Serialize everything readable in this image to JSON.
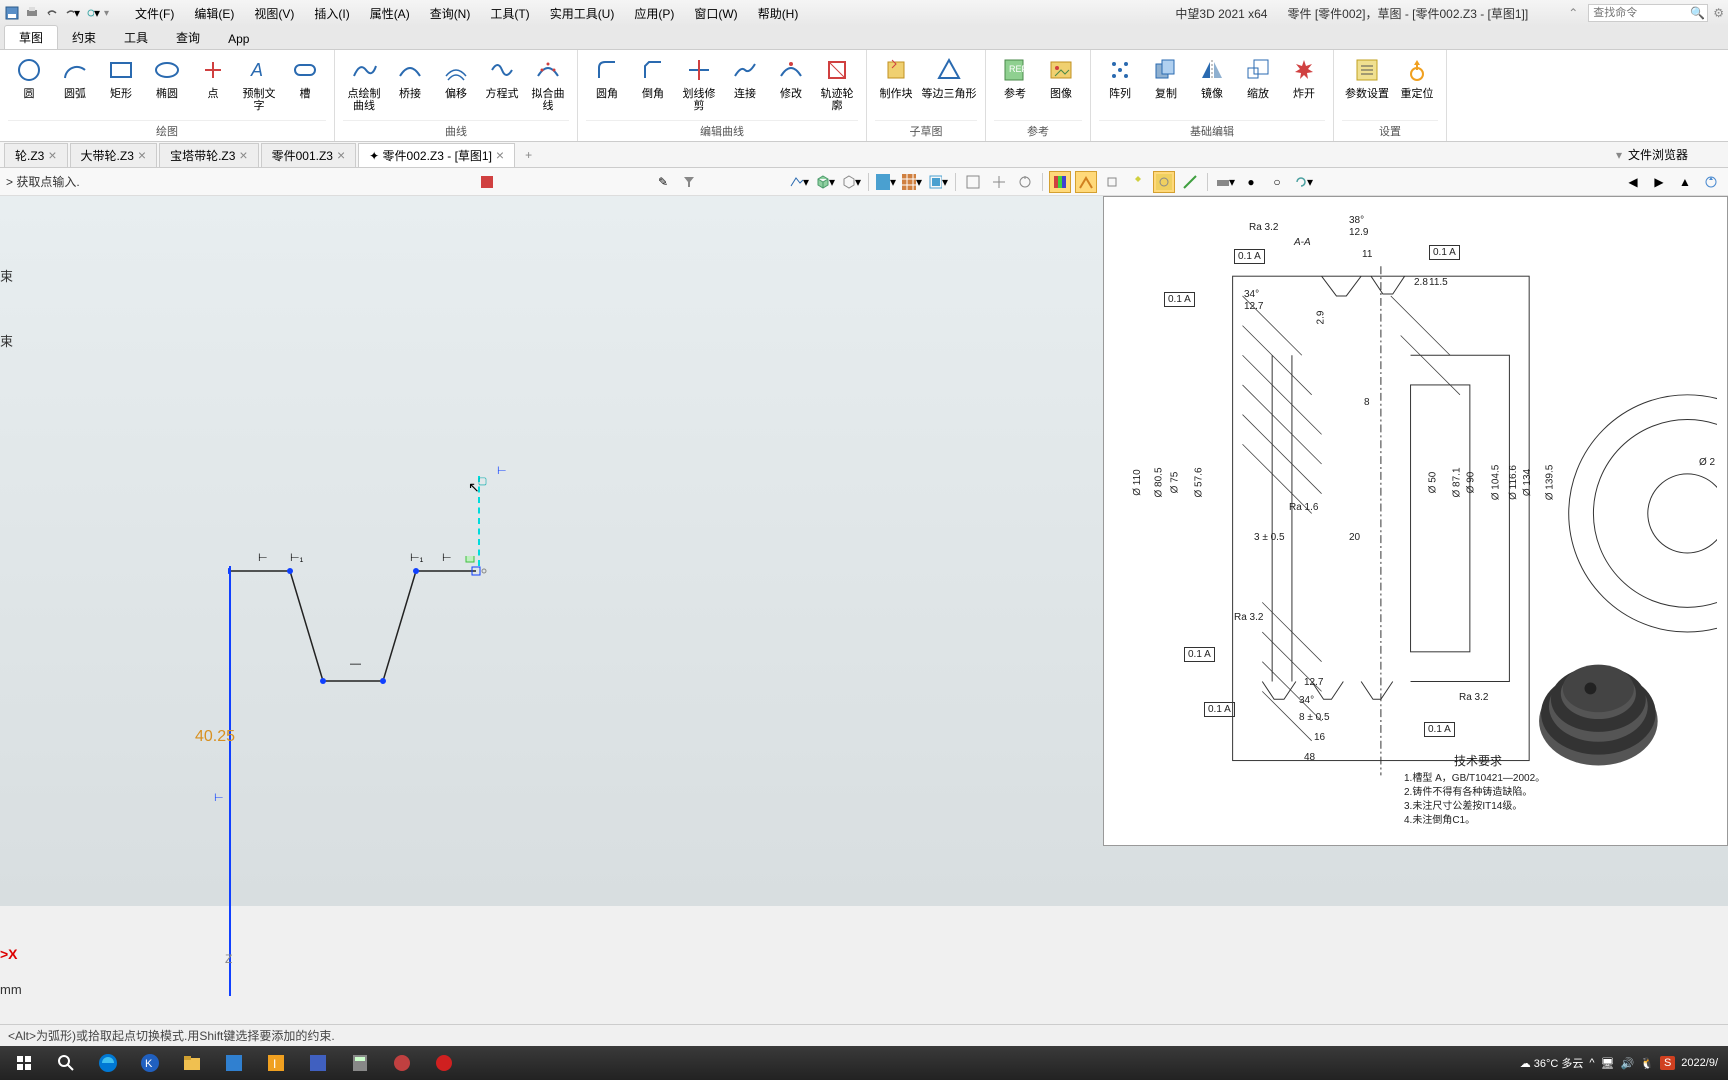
{
  "titlebar": {
    "menus": [
      "文件(F)",
      "编辑(E)",
      "视图(V)",
      "插入(I)",
      "属性(A)",
      "查询(N)",
      "工具(T)",
      "实用工具(U)",
      "应用(P)",
      "窗口(W)",
      "帮助(H)"
    ],
    "app_name": "中望3D 2021 x64",
    "doc_title": "零件 [零件002]，草图 - [零件002.Z3 - [草图1]]",
    "search_placeholder": "查找命令"
  },
  "ribbon_tabs": [
    "草图",
    "约束",
    "工具",
    "查询",
    "App"
  ],
  "ribbon_active_tab": 0,
  "ribbon_groups": [
    {
      "label": "绘图",
      "tools": [
        "圆",
        "圆弧",
        "矩形",
        "椭圆",
        "点",
        "预制文字",
        "槽"
      ]
    },
    {
      "label": "曲线",
      "tools": [
        "点绘制曲线",
        "桥接",
        "偏移",
        "方程式",
        "拟合曲线"
      ]
    },
    {
      "label": "编辑曲线",
      "tools": [
        "圆角",
        "倒角",
        "划线修剪",
        "连接",
        "修改",
        "轨迹轮廓"
      ]
    },
    {
      "label": "子草图",
      "tools": [
        "制作块",
        "等边三角形"
      ]
    },
    {
      "label": "参考",
      "tools": [
        "参考",
        "图像"
      ]
    },
    {
      "label": "基础编辑",
      "tools": [
        "阵列",
        "复制",
        "镜像",
        "缩放",
        "炸开"
      ]
    },
    {
      "label": "设置",
      "tools": [
        "参数设置",
        "重定位"
      ]
    }
  ],
  "doc_tabs": [
    {
      "name": "轮.Z3",
      "active": false
    },
    {
      "name": "大带轮.Z3",
      "active": false
    },
    {
      "name": "宝塔带轮.Z3",
      "active": false
    },
    {
      "name": "零件001.Z3",
      "active": false
    },
    {
      "name": "✦ 零件002.Z3 - [草图1]",
      "active": true
    }
  ],
  "right_panel_title": "文件浏览器",
  "prompt_text": "> 获取点输入.",
  "constraint_labels": [
    "束",
    "束"
  ],
  "sketch": {
    "dimension": "40.25",
    "axis_x_label": ">X",
    "axis_z_label": "Z",
    "units": "mm",
    "hmarks": [
      "⊢",
      "⊢₁",
      "⊢₁",
      "⊢"
    ]
  },
  "status_text": "<Alt>为弧形)或拾取起点切换模式.用Shift键选择要添加的约束.",
  "tray": {
    "weather": "36°C 多云",
    "date": "2022/9/"
  },
  "ref_drawing": {
    "title_section": "A-A",
    "top_angle1": "38°",
    "top_dim1": "12.9",
    "top_dim2": "11",
    "ra_top": "Ra 3.2",
    "mid_angle": "34°",
    "mid_dim": "12.7",
    "small_dims": [
      "2.8",
      "2.9",
      "11.5"
    ],
    "diameters": [
      "Ø 110",
      "Ø 80.5",
      "Ø 75",
      "Ø 57.6",
      "Ø 50",
      "Ø 87.1",
      "Ø 90",
      "Ø 104.5",
      "Ø 116.6",
      "Ø 134",
      "Ø 139.5"
    ],
    "ra_mid": "Ra 1.6",
    "h_dims": [
      "8",
      "20",
      "3 ± 0.5",
      "8 ± 0.5",
      "16",
      "48",
      "12.7"
    ],
    "bottom_angle": "34°",
    "ra_bottom": "Ra 3.2",
    "ra_right": "Ra 3.2",
    "tol_boxes": [
      "0.1  A",
      "0.1  A",
      "0.1  A",
      "0.1  A",
      "0.1  A",
      "0.1  A"
    ],
    "tech_title": "技术要求",
    "tech_lines": [
      "1.槽型 A，GB/T10421—2002。",
      "2.铸件不得有各种铸造缺陷。",
      "3.未注尺寸公差按IT14级。",
      "4.未注倒角C1。"
    ],
    "right_diameter": "Ø 2"
  }
}
